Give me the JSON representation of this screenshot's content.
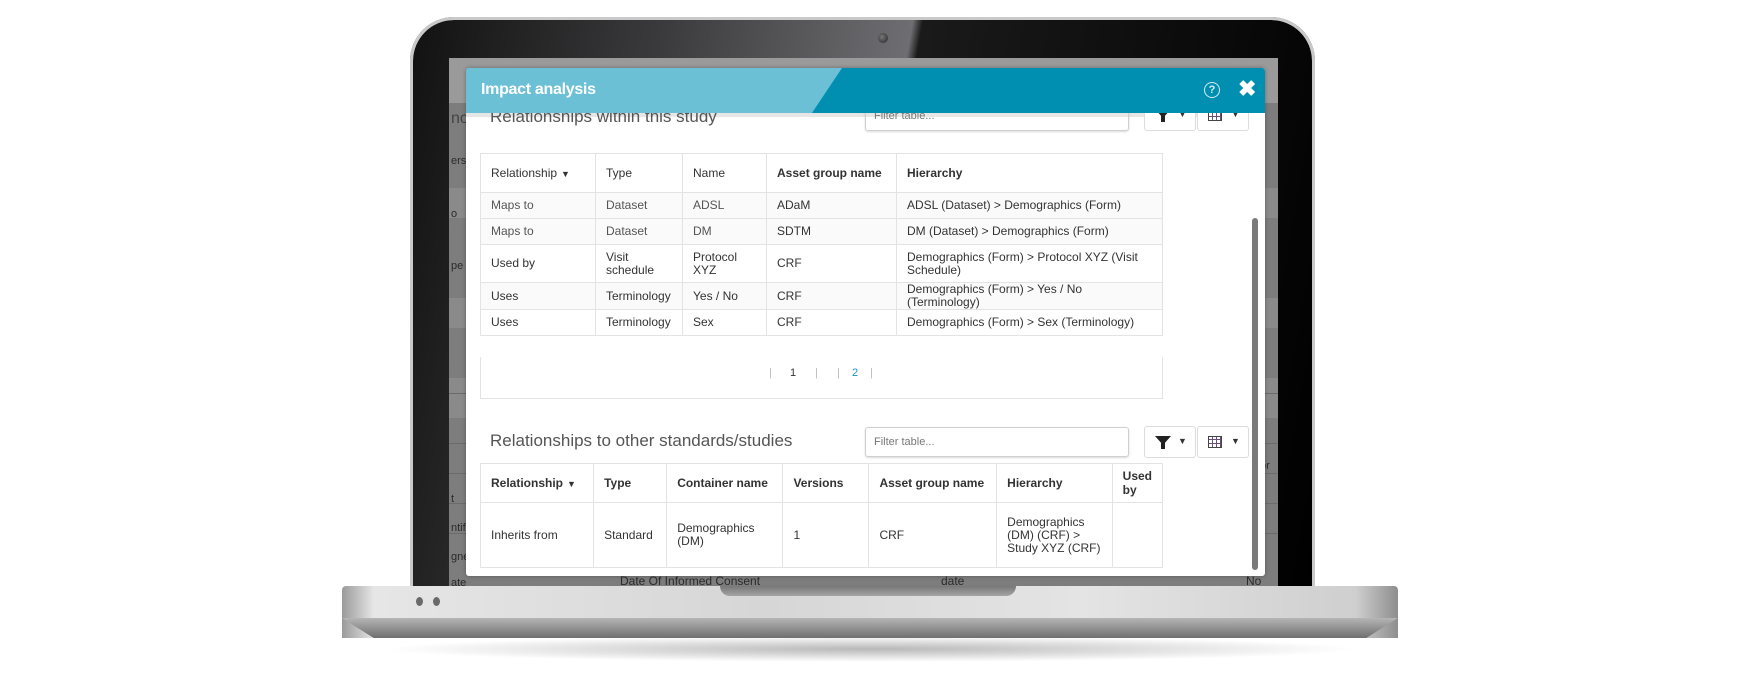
{
  "modal": {
    "title": "Impact analysis",
    "help_icon": "?",
    "close_icon": "✖",
    "colors": {
      "header_light": "#6cc0d6",
      "header_dark": "#008fb0"
    }
  },
  "section1": {
    "title": "Relationships within this study",
    "filter_placeholder": "Filter table...",
    "columns": [
      "Relationship",
      "Type",
      "Name",
      "Asset group name",
      "Hierarchy"
    ],
    "sort_indicator": "▼",
    "rows": [
      [
        "Maps to",
        "Dataset",
        "ADSL",
        "ADaM",
        "ADSL (Dataset) > Demographics (Form)"
      ],
      [
        "Maps to",
        "Dataset",
        "DM",
        "SDTM",
        "DM (Dataset) > Demographics (Form)"
      ],
      [
        "Used by",
        "Visit schedule",
        "Protocol XYZ",
        "CRF",
        "Demographics (Form) > Protocol XYZ (Visit Schedule)"
      ],
      [
        "Uses",
        "Terminology",
        "Yes / No",
        "CRF",
        "Demographics (Form) > Yes / No (Terminology)"
      ],
      [
        "Uses",
        "Terminology",
        "Sex",
        "CRF",
        "Demographics (Form) > Sex (Terminology)"
      ]
    ],
    "pagination": {
      "pages": [
        "1",
        "2"
      ],
      "current": "1",
      "sep": "|"
    }
  },
  "section2": {
    "title": "Relationships to other standards/studies",
    "filter_placeholder": "Filter table...",
    "columns": [
      "Relationship",
      "Type",
      "Container name",
      "Versions",
      "Asset group name",
      "Hierarchy",
      "Used by"
    ],
    "sort_indicator": "▼",
    "rows": [
      [
        "Inherits from",
        "Standard",
        "Demographics (DM)",
        "1",
        "CRF",
        "Demographics (DM) (CRF) > Study XYZ (CRF)",
        ""
      ]
    ]
  },
  "background": {
    "left_fragments": [
      "nog",
      "ers",
      "o",
      "pe",
      "t",
      "ntif",
      "gne",
      "ate"
    ],
    "right_fragment": "tor",
    "bottom_row": [
      "Date Of Informed Consent",
      "date",
      "No"
    ]
  }
}
